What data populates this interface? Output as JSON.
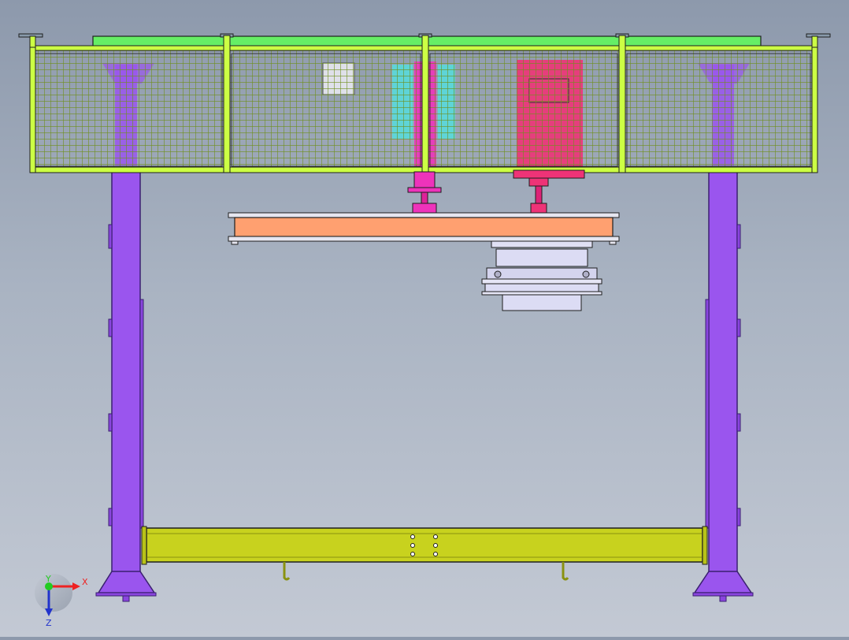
{
  "viewport": {
    "colors": {
      "background_top": "#8d99ac",
      "background_bottom": "#c3c9d4",
      "guard_frame": "#ccff44",
      "guard_mesh": "#7a9a20",
      "top_plate": "#66ee66",
      "column": "#9a55ee",
      "column_outline": "#3a2070",
      "crossbeam": "#c8d21e",
      "beam": "#ffa070",
      "cylinder_magenta": "#ee33bb",
      "cylinder_teal": "#55dddd",
      "tooling": "#dcdcf4",
      "outline": "#1e1e1e"
    },
    "triad": {
      "x_label": "X",
      "y_label": "Y",
      "z_label": "Z",
      "x_color": "#ee2222",
      "y_color": "#22cc22",
      "z_color": "#2233cc"
    }
  }
}
